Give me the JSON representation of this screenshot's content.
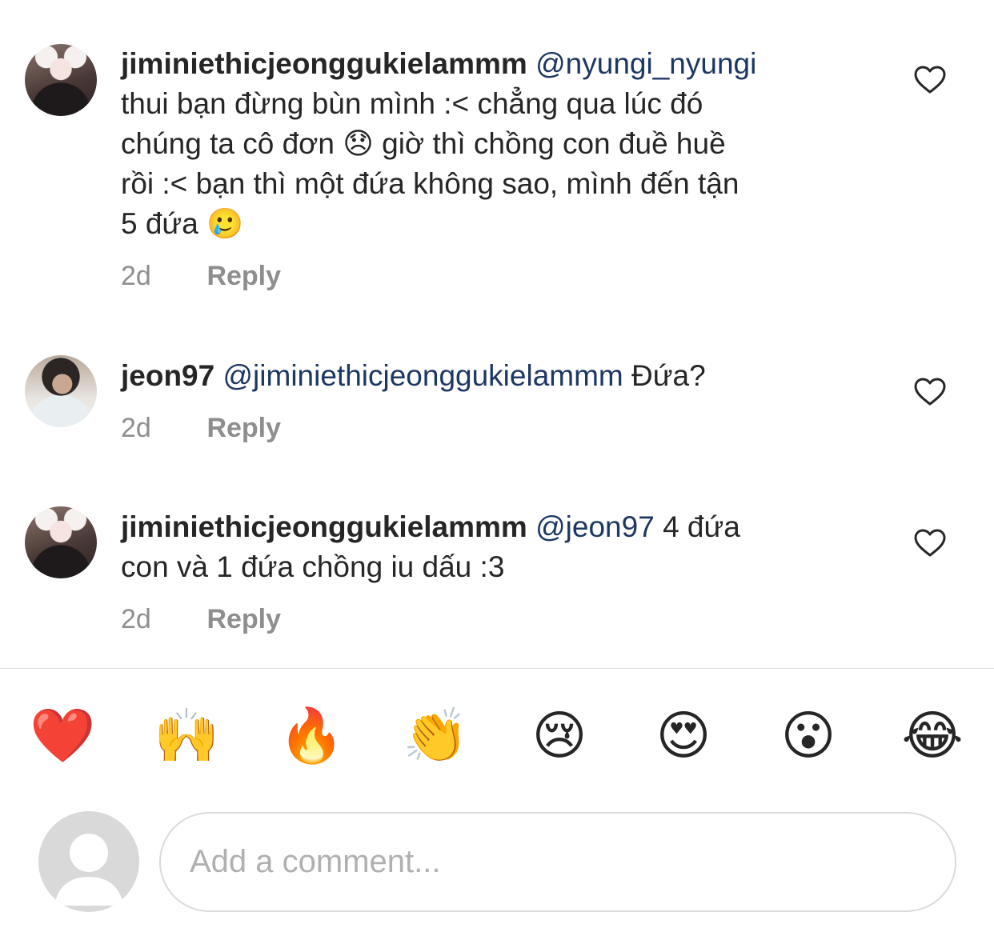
{
  "comments": [
    {
      "username": "jiminiethicjeonggukielammm",
      "mention": "@nyungi_nyungi",
      "lines": [
        "thui bạn đừng bùn mình :< chẳng qua lúc đó",
        "chúng ta cô đơn 😞 giờ thì chồng con đuề huề",
        "rồi :< bạn thì một đứa không sao, mình đến tận",
        "5 đứa 🥲"
      ],
      "time": "2d",
      "reply": "Reply",
      "icon": "heart-outline-icon"
    },
    {
      "username": "jeon97",
      "mention": "@jiminiethicjeonggukielammm",
      "lines": [
        "Đứa?"
      ],
      "time": "2d",
      "reply": "Reply",
      "icon": "heart-outline-icon"
    },
    {
      "username": "jiminiethicjeonggukielammm",
      "mention": "@jeon97",
      "lines": [
        "4 đứa",
        "con và 1 đứa chồng iu dấu :3"
      ],
      "time": "2d",
      "reply": "Reply",
      "icon": "heart-outline-icon"
    }
  ],
  "quick_reactions": [
    "❤️",
    "🙌",
    "🔥",
    "👏",
    "😢",
    "😍",
    "😮",
    "😂"
  ],
  "composer": {
    "placeholder": "Add a comment...",
    "avatar_icon": "default-user-icon"
  },
  "colors": {
    "text": "#262626",
    "mention": "#1d3763",
    "meta": "#8e8e8e",
    "divider": "#dbdbdb"
  }
}
